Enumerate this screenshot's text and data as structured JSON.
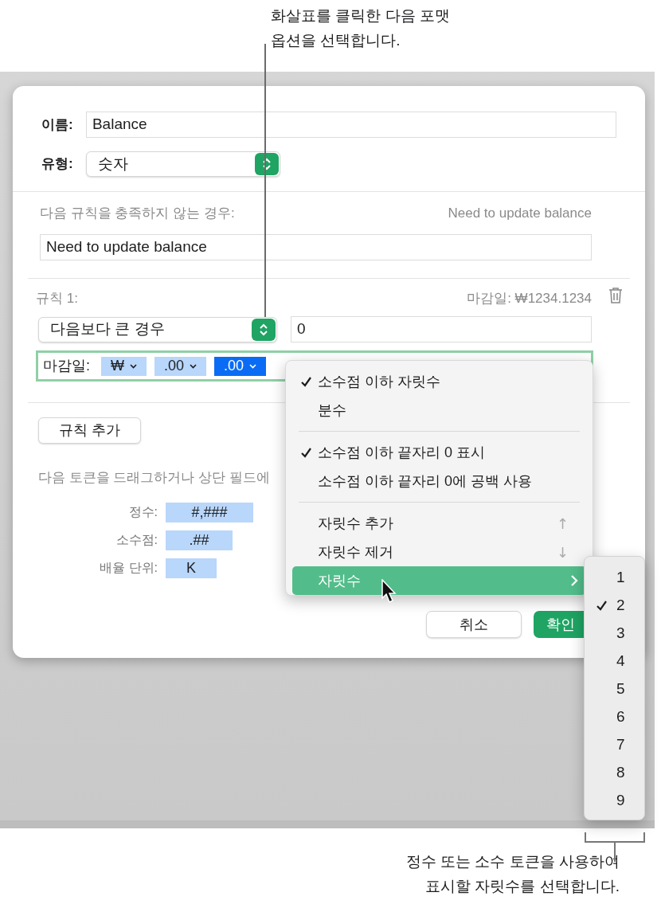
{
  "callouts": [
    {
      "kind": "top",
      "lines": [
        "화살표를 클릭한 다음 포맷",
        "옵션을 선택합니다."
      ]
    },
    {
      "kind": "bottom",
      "lines": [
        "정수 또는 소수 토큰을 사용하여",
        "표시할 자릿수를 선택합니다."
      ]
    }
  ],
  "dialog": {
    "name_label": "이름:",
    "name_value": "Balance",
    "type_label": "유형:",
    "type_value": "숫자",
    "condition_label": "다음 규칙을 충족하지 않는 경우:",
    "condition_preview": "Need to update balance",
    "condition_message": "Need to update balance",
    "rule": {
      "title": "규칙 1:",
      "preview": "마감일: ₩1234.1234",
      "operator": "다음보다 큰 경우",
      "value": "0",
      "format_label": "마감일:",
      "tokens": [
        {
          "text": "₩",
          "selected": false
        },
        {
          "text": ".00",
          "selected": false
        },
        {
          "text": ".00",
          "selected": true
        }
      ]
    },
    "add_rule_button": "규칙 추가",
    "hint": "다음 토큰을 드래그하거나 상단 필드에",
    "token_list": [
      {
        "label": "정수:",
        "token": "#,###"
      },
      {
        "label": "소수점:",
        "token": ".##"
      },
      {
        "label": "배율 단위:",
        "token": "K"
      }
    ],
    "buttons": [
      {
        "label": "취소",
        "kind": "secondary"
      },
      {
        "label": "확인",
        "kind": "primary"
      }
    ]
  },
  "menu": {
    "items": [
      {
        "kind": "item",
        "label": "소수점 이하 자릿수",
        "checked": true
      },
      {
        "kind": "item",
        "label": "분수",
        "checked": false
      },
      {
        "kind": "separator"
      },
      {
        "kind": "item",
        "label": "소수점 이하 끝자리 0 표시",
        "checked": true
      },
      {
        "kind": "item",
        "label": "소수점 이하 끝자리 0에 공백 사용",
        "checked": false
      },
      {
        "kind": "separator"
      },
      {
        "kind": "item",
        "label": "자릿수 추가",
        "checked": false,
        "shortcut": "↑"
      },
      {
        "kind": "item",
        "label": "자릿수 제거",
        "checked": false,
        "shortcut": "↓"
      },
      {
        "kind": "submenu",
        "label": "자릿수",
        "selected": true
      }
    ]
  },
  "submenu": {
    "items": [
      {
        "label": "1",
        "checked": false
      },
      {
        "label": "2",
        "checked": true
      },
      {
        "label": "3",
        "checked": false
      },
      {
        "label": "4",
        "checked": false
      },
      {
        "label": "5",
        "checked": false
      },
      {
        "label": "6",
        "checked": false
      },
      {
        "label": "7",
        "checked": false
      },
      {
        "label": "8",
        "checked": false
      },
      {
        "label": "9",
        "checked": false
      }
    ]
  }
}
